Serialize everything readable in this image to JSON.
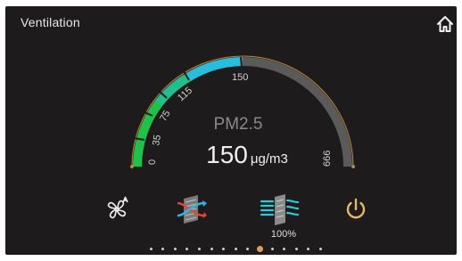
{
  "header": {
    "title": "Ventilation",
    "home_icon": "home-icon"
  },
  "gauge": {
    "metric_label": "PM2.5",
    "value": "150",
    "unit": "μg/m3",
    "min": 0,
    "max": 666,
    "current": 150,
    "scale_labels": [
      "0",
      "35",
      "75",
      "115",
      "150",
      "666"
    ],
    "colors": {
      "low": "#20c14a",
      "mid": "#26c2c8",
      "high": "#2aa3e3",
      "track": "#5a5a5a",
      "outline": "#b9893e"
    }
  },
  "controls": {
    "fan_mode_icon": "fan-auto-icon",
    "heat_exchange_icon": "heat-exchanger-icon",
    "airflow_icon": "airflow-filter-icon",
    "airflow_label": "100%",
    "power_icon": "power-icon",
    "power_color": "#e8b56a"
  },
  "pagination": {
    "total": 15,
    "active_index": 9
  }
}
